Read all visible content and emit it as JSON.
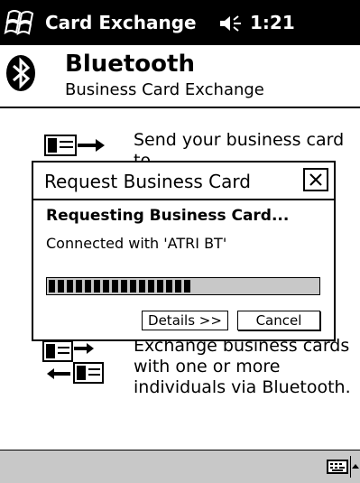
{
  "titlebar": {
    "app_title": "Card Exchange",
    "time": "1:21",
    "start_icon": "windows-flag-icon",
    "volume_icon": "speaker-icon"
  },
  "header": {
    "logo_icon": "bluetooth-icon",
    "title": "Bluetooth",
    "subtitle": "Business Card Exchange"
  },
  "options": [
    {
      "icon": "send-card-icon",
      "text": "Send your business card to\none or more recipients."
    },
    {
      "icon": "exchange-cards-icon",
      "text": "Exchange business cards\nwith one or more\nindividuals via Bluetooth."
    }
  ],
  "dialog": {
    "title": "Request Business Card",
    "close_icon": "close-icon",
    "heading": "Requesting Business Card...",
    "status": "Connected with 'ATRI BT'",
    "progress": 0.52,
    "buttons": {
      "details": "Details >>",
      "cancel": "Cancel"
    }
  },
  "bottombar": {
    "keyboard_icon": "keyboard-icon",
    "sip_arrow_icon": "up-arrow-icon"
  },
  "colors": {
    "titlebar_bg": "#000000",
    "titlebar_fg": "#ffffff",
    "bottombar_bg": "#c8c8c8",
    "progress_track": "#c8c8c8",
    "progress_fill": "#000000"
  }
}
